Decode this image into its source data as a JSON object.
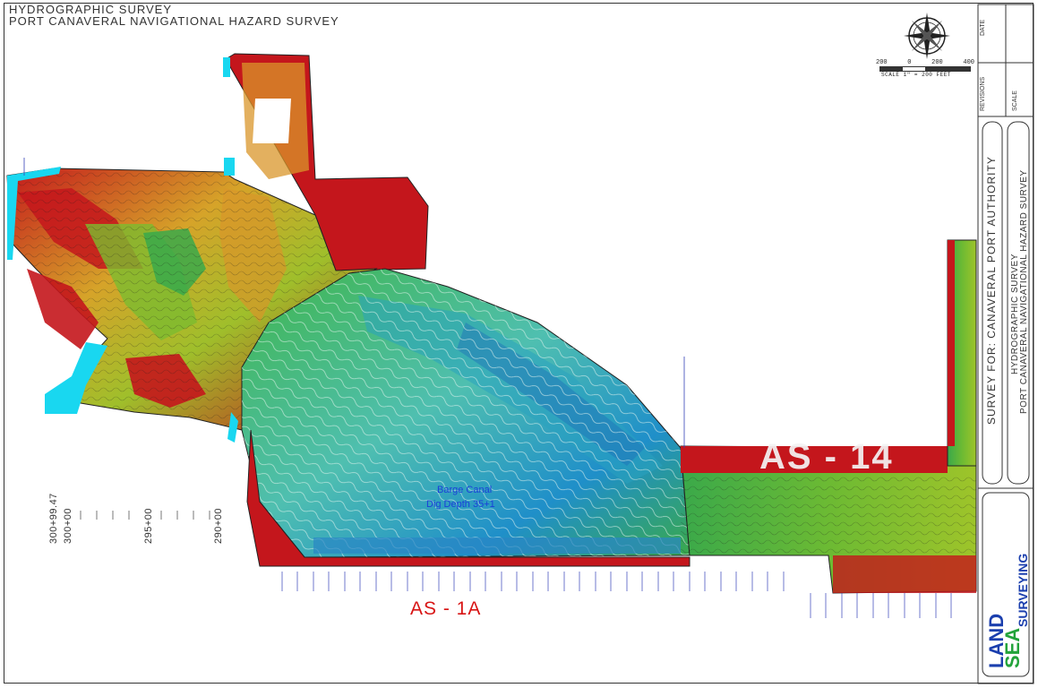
{
  "header": {
    "line1": "HYDROGRAPHIC SURVEY",
    "line2": "PORT CANAVERAL NAVIGATIONAL HAZARD SURVEY"
  },
  "stations": {
    "s1": "300+99.47",
    "s2": "300+00",
    "s3": "295+00",
    "s4": "290+00"
  },
  "sections": {
    "left": "AS - 1A",
    "right": "AS - 14"
  },
  "annotations": {
    "canal_line1": "Barge Canal",
    "canal_line2": "Dig Depth 35+1"
  },
  "scale": {
    "n1": "200",
    "n2": "0",
    "n3": "200",
    "n4": "400",
    "units": "SCALE   1\" = 200   FEET"
  },
  "title_block": {
    "client": "SURVEY FOR: CANAVERAL PORT AUTHORITY",
    "survey_line1": "HYDROGRAPHIC SURVEY",
    "survey_line2": "PORT CANAVERAL NAVIGATIONAL HAZARD SURVEY",
    "revisions": "REVISIONS",
    "scale_label": "SCALE",
    "date_label": "DATE"
  },
  "logo": {
    "line1": "LAND",
    "line2": "SEA",
    "line3": "SURVEYING"
  },
  "colors": {
    "deep": "#1a9cc8",
    "mid": "#2fae3a",
    "shallow": "#c9cf2a",
    "orange": "#e07a1c",
    "land": "#c4161c",
    "edge": "#19d7f0"
  }
}
